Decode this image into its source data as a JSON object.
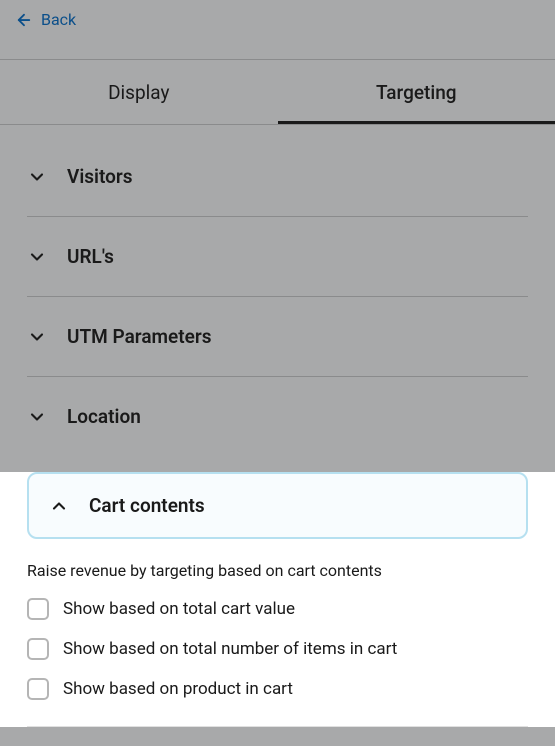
{
  "header": {
    "back_label": "Back"
  },
  "tabs": {
    "display": "Display",
    "targeting": "Targeting"
  },
  "sections": {
    "visitors": "Visitors",
    "urls": "URL's",
    "utm": "UTM Parameters",
    "location": "Location",
    "cart": "Cart contents"
  },
  "cart_panel": {
    "description": "Raise revenue by targeting based on cart contents",
    "option_value": "Show based on total cart value",
    "option_items": "Show based on total number of items in cart",
    "option_product": "Show based on product in cart"
  }
}
